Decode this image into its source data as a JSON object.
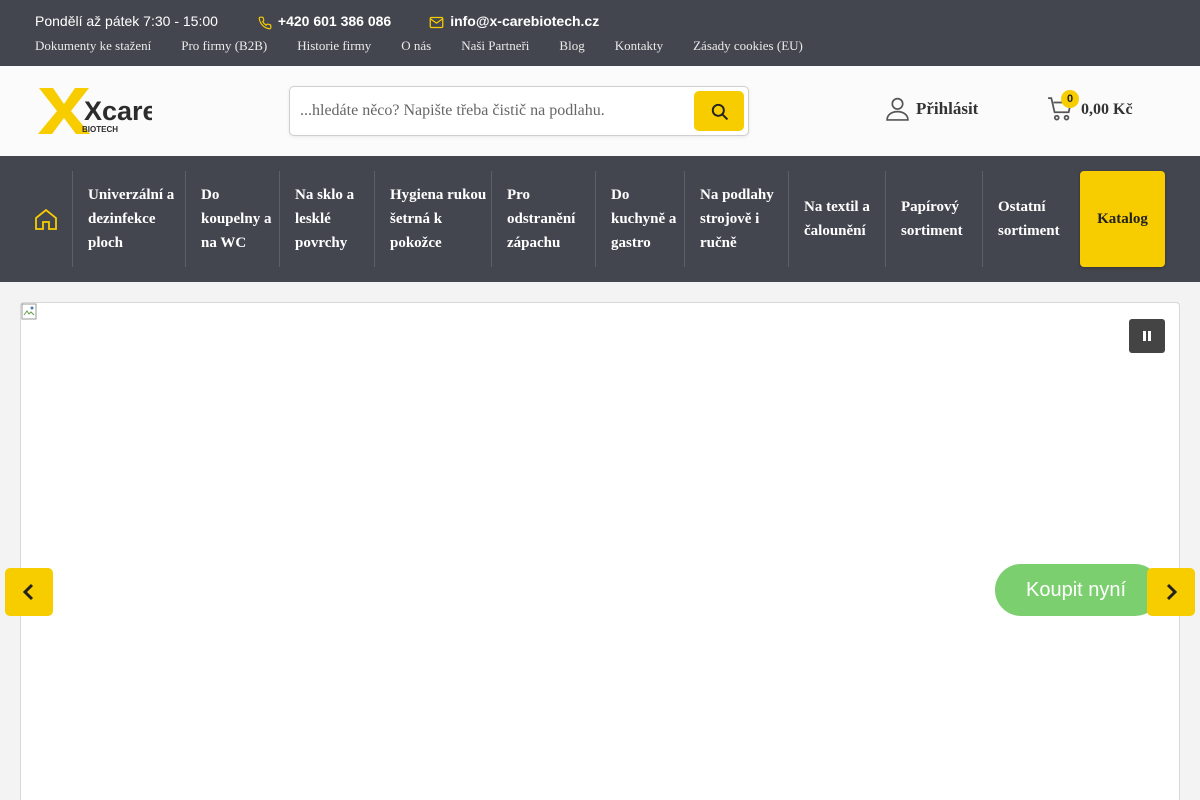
{
  "topbar": {
    "hours": "Pondělí až pátek 7:30 - 15:00",
    "phone": "+420 601 386 086",
    "email": "info@x-carebiotech.cz",
    "links": [
      "Dokumenty ke stažení",
      "Pro firmy (B2B)",
      "Historie firmy",
      "O nás",
      "Naši Partneři",
      "Blog",
      "Kontakty",
      "Zásady cookies (EU)"
    ]
  },
  "header": {
    "logo_text": "Xcare",
    "logo_sub": "BIOTECH",
    "search_placeholder": "...hledáte něco? Napište třeba čistič na podlahu.",
    "login_label": "Přihlásit",
    "cart_count": "0",
    "cart_total": "0,00 Kč"
  },
  "nav": {
    "items": [
      "Univerzální a dezinfekce ploch",
      "Do koupelny a na WC",
      "Na sklo a lesklé povrchy",
      "Hygiena rukou šetrná k pokožce",
      "Pro odstranění zápachu",
      "Do kuchyně a gastro",
      "Na podlahy strojově i ručně",
      "Na textil a čalounění",
      "Papírový sortiment",
      "Ostatní sortiment"
    ],
    "katalog": "Katalog"
  },
  "slider": {
    "cta": "Koupit nyní"
  },
  "colors": {
    "dark_bar": "#44464f",
    "accent_yellow": "#f7cd00",
    "cta_green": "#7ccf6f"
  },
  "icons": [
    "phone-icon",
    "mail-icon",
    "search-icon",
    "user-icon",
    "cart-icon",
    "home-icon",
    "pause-icon",
    "chevron-left-icon",
    "chevron-right-icon"
  ]
}
